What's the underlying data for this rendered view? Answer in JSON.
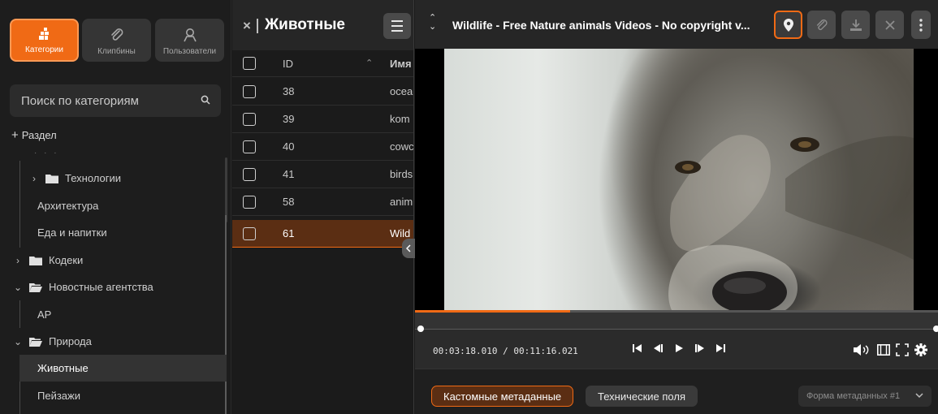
{
  "sidebar": {
    "tabs": [
      {
        "label": "Категории",
        "icon": "categories-icon",
        "active": true
      },
      {
        "label": "Клипбины",
        "icon": "paperclip-icon",
        "active": false
      },
      {
        "label": "Пользователи",
        "icon": "user-icon",
        "active": false
      }
    ],
    "search": {
      "placeholder": "Поиск по категориям",
      "icon": "search-icon"
    },
    "add_section_label": "Раздел",
    "tree": [
      {
        "label": "Технологии",
        "type": "folder",
        "expanded": false
      },
      {
        "label": "Архитектура",
        "type": "leaf"
      },
      {
        "label": "Еда и напитки",
        "type": "leaf"
      },
      {
        "label": "Кодеки",
        "type": "folder",
        "expanded": false
      },
      {
        "label": "Новостные агентства",
        "type": "folder",
        "expanded": true
      },
      {
        "label": "AP",
        "type": "leaf"
      },
      {
        "label": "Природа",
        "type": "folder",
        "expanded": true
      },
      {
        "label": "Животные",
        "type": "leaf",
        "selected": true
      },
      {
        "label": "Пейзажи",
        "type": "leaf"
      }
    ]
  },
  "list": {
    "title": "Животные",
    "columns": {
      "id": "ID",
      "name": "Имя"
    },
    "rows": [
      {
        "id": "38",
        "name": "ocea"
      },
      {
        "id": "39",
        "name": "kom"
      },
      {
        "id": "40",
        "name": "cowc"
      },
      {
        "id": "41",
        "name": "birds"
      },
      {
        "id": "58",
        "name": "anim"
      },
      {
        "id": "61",
        "name": "Wild",
        "selected": true
      }
    ]
  },
  "player": {
    "title": "Wildlife - Free Nature animals Videos - No copyright v...",
    "timecode": "00:03:18.010 / 00:11:16.021",
    "progress_fraction": 0.297,
    "meta_tabs": {
      "custom": "Кастомные метаданные",
      "technical": "Технические поля"
    },
    "meta_form": "Форма метаданных #1"
  },
  "colors": {
    "accent": "#f06a15",
    "background": "#1b1b1b",
    "panel": "#262626"
  }
}
